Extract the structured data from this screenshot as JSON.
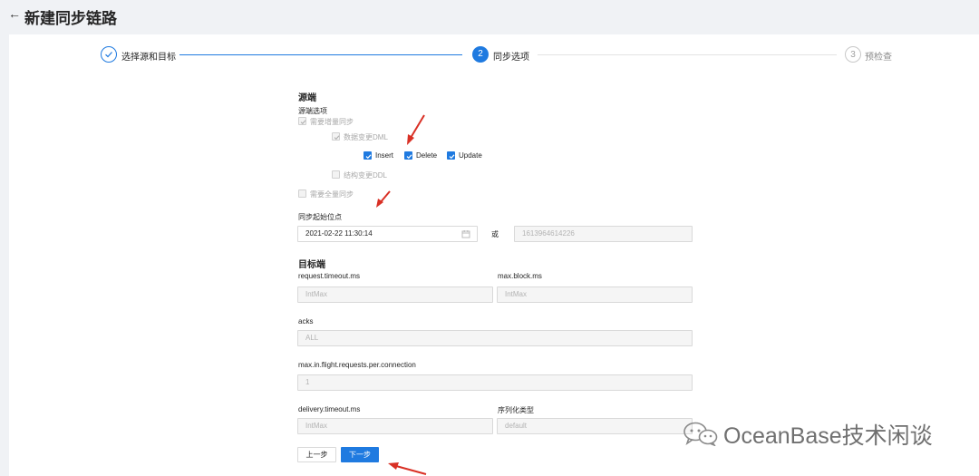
{
  "header": {
    "back_icon": "arrow-left-icon",
    "title": "新建同步链路"
  },
  "steps": [
    {
      "index": "1",
      "label": "选择源和目标",
      "status": "done"
    },
    {
      "index": "2",
      "label": "同步选项",
      "status": "active"
    },
    {
      "index": "3",
      "label": "预检查",
      "status": "wait"
    }
  ],
  "source": {
    "title": "源端",
    "options_label": "源端选项",
    "incremental_label": "需要增量同步",
    "dml_label": "数据变更DML",
    "dml_ops": [
      "Insert",
      "Delete",
      "Update"
    ],
    "ddl_label": "结构变更DDL",
    "full_label": "需要全量同步",
    "start_label": "同步起始位点",
    "start_time": "2021-02-22 11:30:14",
    "or_label": "或",
    "start_offset_placeholder": "1613964614226"
  },
  "target": {
    "title": "目标端",
    "fields": {
      "request_timeout": {
        "label": "request.timeout.ms",
        "value": "IntMax"
      },
      "max_block": {
        "label": "max.block.ms",
        "value": "IntMax"
      },
      "acks": {
        "label": "acks",
        "value": "ALL"
      },
      "max_in_flight": {
        "label": "max.in.flight.requests.per.connection",
        "value": "1"
      },
      "delivery_timeout": {
        "label": "delivery.timeout.ms",
        "value": "IntMax"
      },
      "serializer": {
        "label": "序列化类型",
        "value": "default"
      }
    }
  },
  "buttons": {
    "prev": "上一步",
    "next": "下一步"
  },
  "watermark": {
    "text": "OceanBase技术闲谈"
  },
  "colors": {
    "primary": "#1f7ae0",
    "annotation_arrow": "#d93025"
  }
}
